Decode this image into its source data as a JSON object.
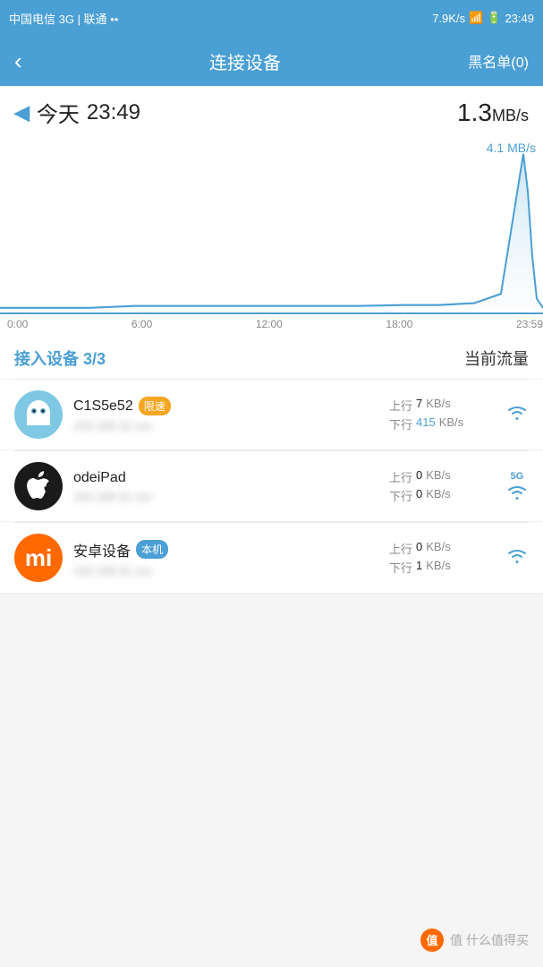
{
  "statusBar": {
    "carrier": "中国电信 3G | 联通 ••",
    "speed": "7.9K/s",
    "time": "23:49",
    "battery": "41"
  },
  "navBar": {
    "backLabel": "‹",
    "title": "连接设备",
    "blacklistLabel": "黑名单(0)"
  },
  "dateRow": {
    "arrowLabel": "◀",
    "dateLabel": "今天",
    "timeLabel": "23:49",
    "speedLabel": "1.3",
    "speedUnit": "MB/s"
  },
  "chart": {
    "maxLabel": "4.1 MB/s",
    "xLabels": [
      "0:00",
      "6:00",
      "12:00",
      "18:00",
      "23:59"
    ]
  },
  "sectionHeader": {
    "leftPrefix": "接入设备 ",
    "leftCount": "3/3",
    "rightLabel": "当前流量"
  },
  "devices": [
    {
      "id": "device-1",
      "avatarType": "ghost",
      "name": "C1S5e52",
      "badge": "限速",
      "badgeType": "orange",
      "mac": "██████████",
      "uploadVal": "7",
      "uploadUnit": "KB/s",
      "downloadVal": "415",
      "downloadUnit": "KB/s",
      "wifiType": "normal"
    },
    {
      "id": "device-2",
      "avatarType": "apple",
      "name": "odeiPad",
      "badge": "",
      "badgeType": "",
      "mac": "██████████",
      "uploadVal": "0",
      "uploadUnit": "KB/s",
      "downloadVal": "0",
      "downloadUnit": "KB/s",
      "wifiType": "5g"
    },
    {
      "id": "device-3",
      "avatarType": "mi",
      "name": "安卓设备",
      "badge": "本机",
      "badgeType": "blue",
      "mac": "██████████",
      "uploadVal": "0",
      "uploadUnit": "KB/s",
      "downloadVal": "1",
      "downloadUnit": "KB/s",
      "wifiType": "normal"
    }
  ],
  "footer": {
    "text": "值 什么值得买"
  }
}
